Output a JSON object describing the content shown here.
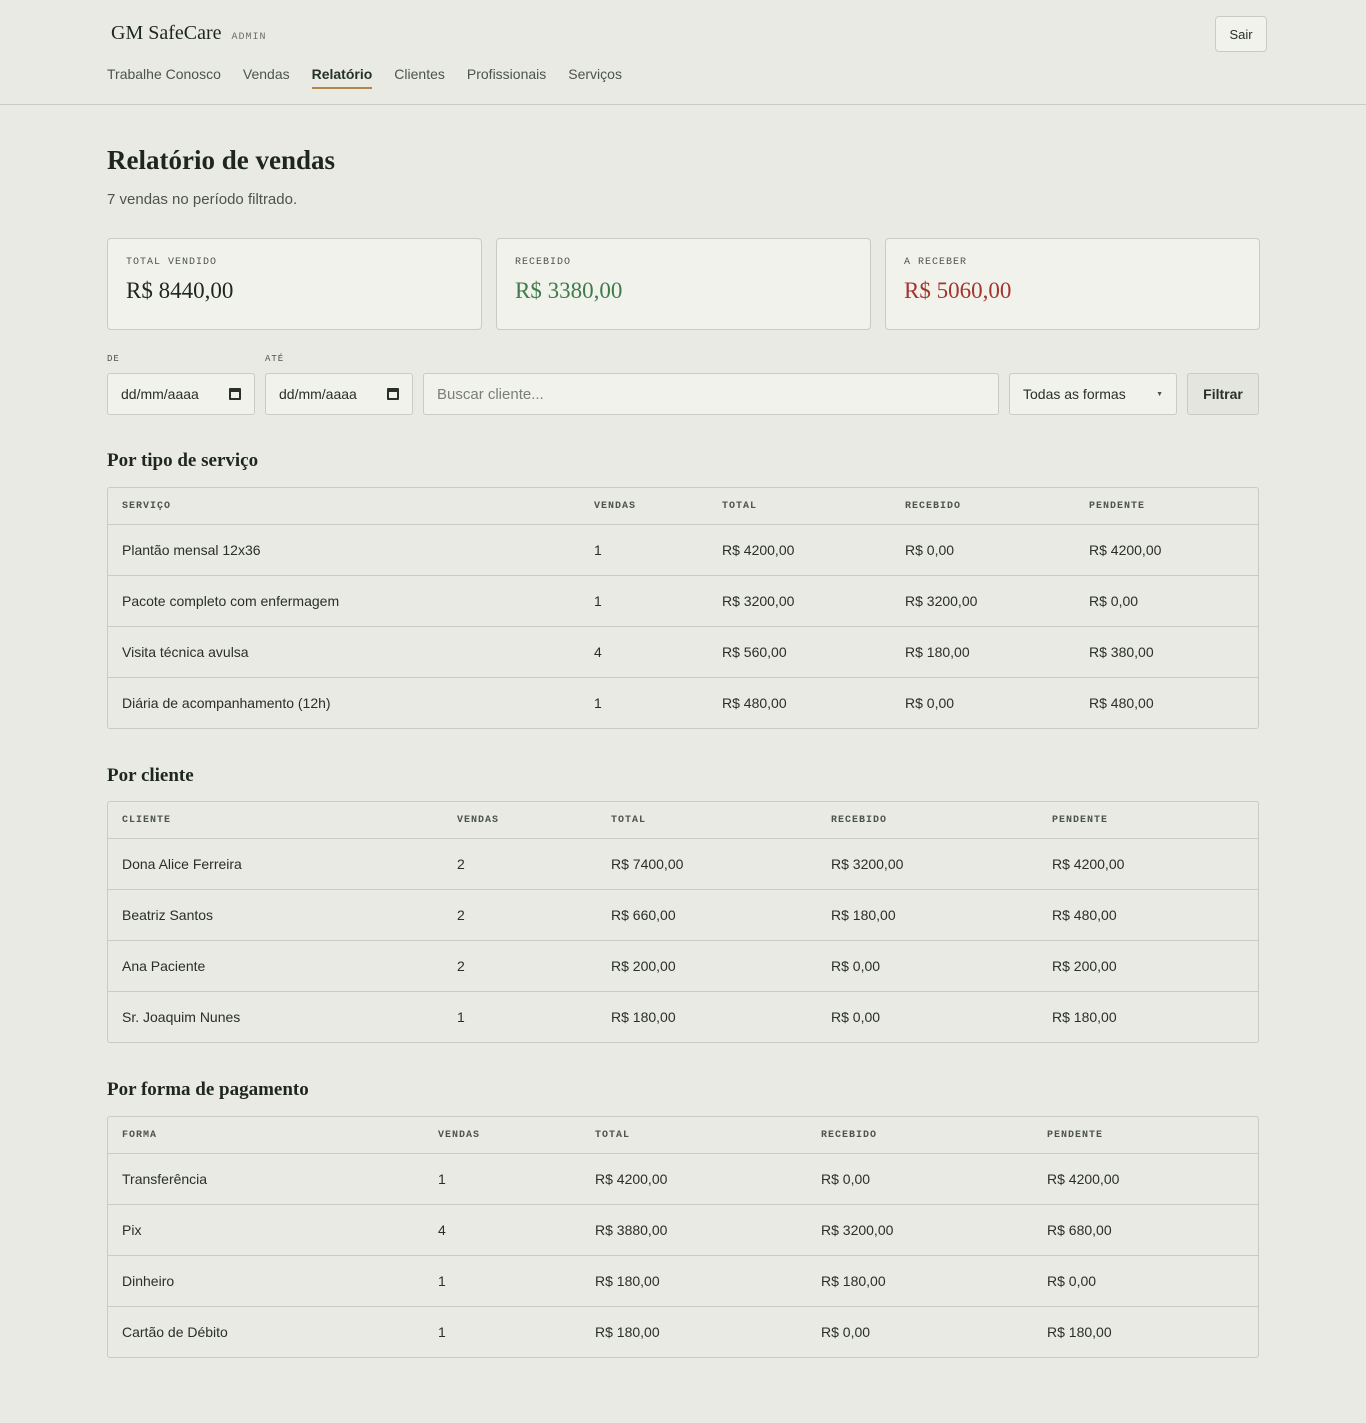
{
  "brand": {
    "name": "GM SafeCare",
    "role": "ADMIN"
  },
  "logout_label": "Sair",
  "nav": [
    {
      "label": "Trabalhe Conosco",
      "active": false
    },
    {
      "label": "Vendas",
      "active": false
    },
    {
      "label": "Relatório",
      "active": true
    },
    {
      "label": "Clientes",
      "active": false
    },
    {
      "label": "Profissionais",
      "active": false
    },
    {
      "label": "Serviços",
      "active": false
    }
  ],
  "page": {
    "title": "Relatório de vendas",
    "subtitle": "7 vendas no período filtrado."
  },
  "cards": [
    {
      "label": "TOTAL VENDIDO",
      "value": "R$ 8440,00",
      "color": "#1f2620"
    },
    {
      "label": "RECEBIDO",
      "value": "R$ 3380,00",
      "color": "#3f7a4c"
    },
    {
      "label": "A RECEBER",
      "value": "R$ 5060,00",
      "color": "#a3352c"
    }
  ],
  "filters": {
    "from_label": "DE",
    "to_label": "ATÉ",
    "from_value": "dd/mm/aaaa",
    "to_value": "dd/mm/aaaa",
    "search_placeholder": "Buscar cliente...",
    "payment_select": "Todas as formas",
    "filter_button": "Filtrar"
  },
  "sections": [
    {
      "title": "Por tipo de serviço",
      "headers": [
        "SERVIÇO",
        "VENDAS",
        "TOTAL",
        "RECEBIDO",
        "PENDENTE"
      ],
      "rows": [
        [
          "Plantão mensal 12x36",
          "1",
          "R$ 4200,00",
          "R$ 0,00",
          "R$ 4200,00"
        ],
        [
          "Pacote completo com enfermagem",
          "1",
          "R$ 3200,00",
          "R$ 3200,00",
          "R$ 0,00"
        ],
        [
          "Visita técnica avulsa",
          "4",
          "R$ 560,00",
          "R$ 180,00",
          "R$ 380,00"
        ],
        [
          "Diária de acompanhamento (12h)",
          "1",
          "R$ 480,00",
          "R$ 0,00",
          "R$ 480,00"
        ]
      ]
    },
    {
      "title": "Por cliente",
      "headers": [
        "CLIENTE",
        "VENDAS",
        "TOTAL",
        "RECEBIDO",
        "PENDENTE"
      ],
      "rows": [
        [
          "Dona Alice Ferreira",
          "2",
          "R$ 7400,00",
          "R$ 3200,00",
          "R$ 4200,00"
        ],
        [
          "Beatriz Santos",
          "2",
          "R$ 660,00",
          "R$ 180,00",
          "R$ 480,00"
        ],
        [
          "Ana Paciente",
          "2",
          "R$ 200,00",
          "R$ 0,00",
          "R$ 200,00"
        ],
        [
          "Sr. Joaquim Nunes",
          "1",
          "R$ 180,00",
          "R$ 0,00",
          "R$ 180,00"
        ]
      ]
    },
    {
      "title": "Por forma de pagamento",
      "headers": [
        "FORMA",
        "VENDAS",
        "TOTAL",
        "RECEBIDO",
        "PENDENTE"
      ],
      "rows": [
        [
          "Transferência",
          "1",
          "R$ 4200,00",
          "R$ 0,00",
          "R$ 4200,00"
        ],
        [
          "Pix",
          "4",
          "R$ 3880,00",
          "R$ 3200,00",
          "R$ 680,00"
        ],
        [
          "Dinheiro",
          "1",
          "R$ 180,00",
          "R$ 180,00",
          "R$ 0,00"
        ],
        [
          "Cartão de Débito",
          "1",
          "R$ 180,00",
          "R$ 0,00",
          "R$ 180,00"
        ]
      ]
    }
  ]
}
